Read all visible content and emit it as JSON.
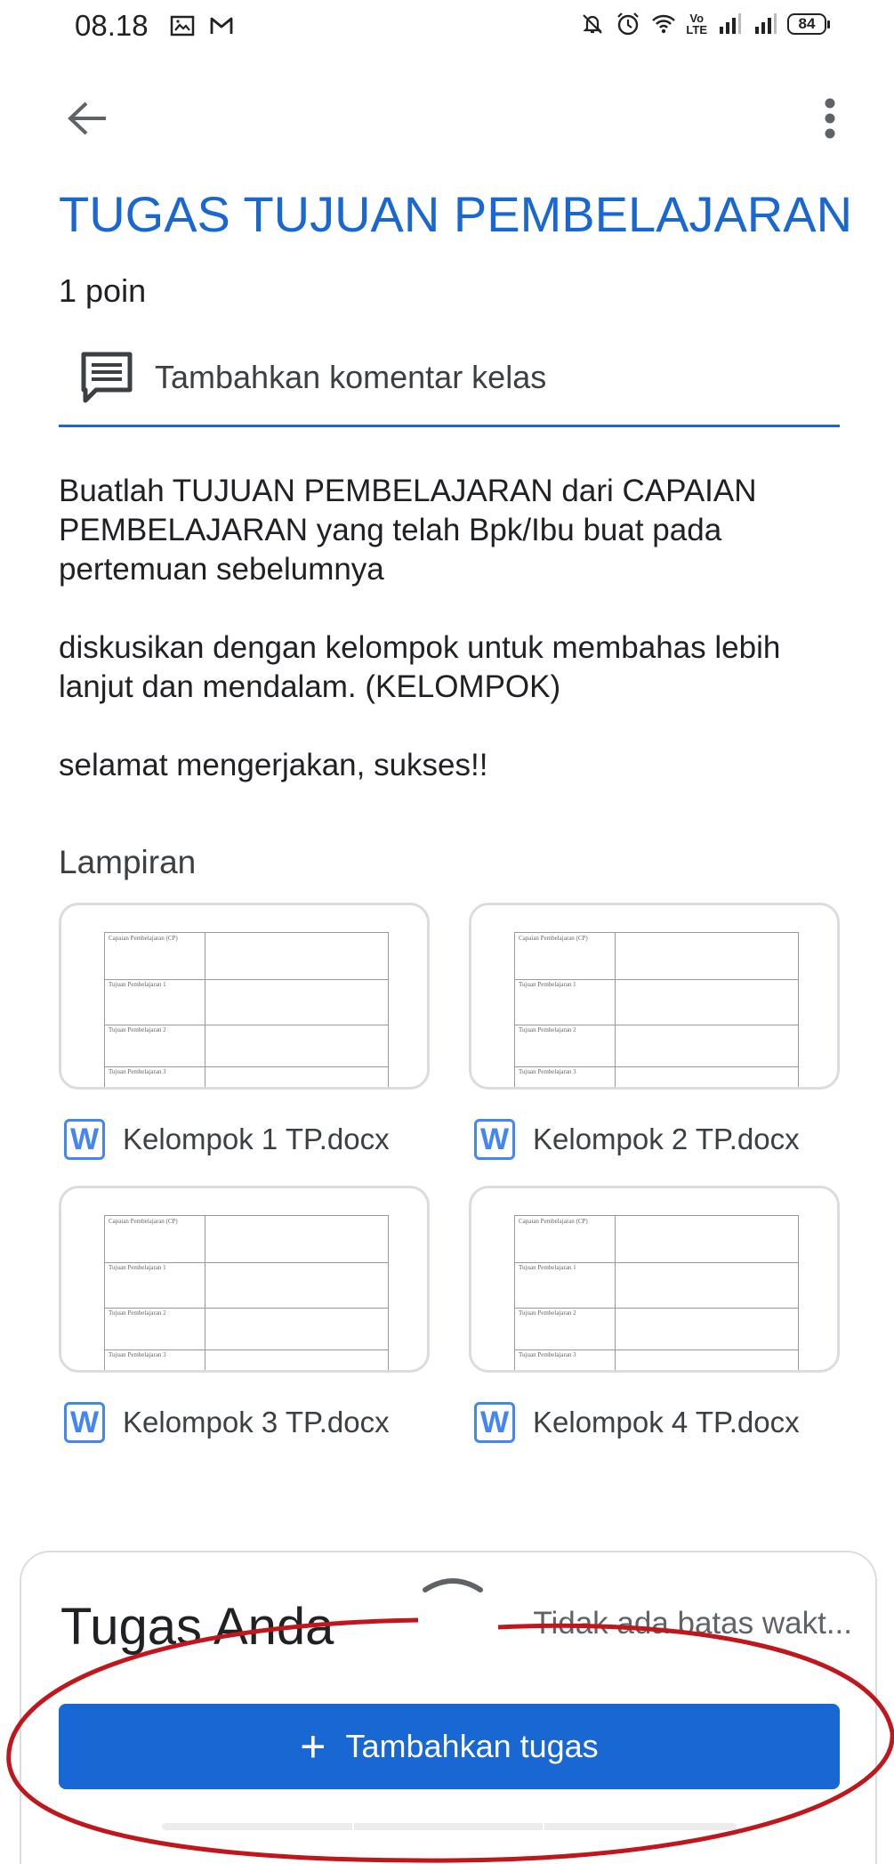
{
  "status_bar": {
    "time": "08.18",
    "volte": "Vo\nLTE",
    "battery": "84",
    "left_icons": [
      "gallery-icon",
      "gmail-icon"
    ],
    "right_icons": [
      "bell-off-icon",
      "alarm-icon",
      "wifi-icon",
      "volte-icon",
      "signal-icon",
      "signal-icon",
      "battery-icon"
    ]
  },
  "header": {
    "back_icon": "arrow-back-icon",
    "more_icon": "more-vert-icon"
  },
  "assignment": {
    "title": "TUGAS TUJUAN PEMBELAJARAN",
    "points": "1 poin",
    "comment_placeholder": "Tambahkan komentar kelas",
    "description": [
      "Buatlah TUJUAN PEMBELAJARAN  dari CAPAIAN PEMBELAJARAN yang telah Bpk/Ibu buat pada pertemuan sebelumnya",
      "diskusikan dengan kelompok untuk membahas lebih lanjut dan mendalam. (KELOMPOK)",
      "selamat mengerjakan, sukses!!"
    ]
  },
  "attachments": {
    "heading": "Lampiran",
    "thumbnail_rows": [
      "Capaian Pembelajaran (CP)",
      "Tujuan Pembelajaran 1",
      "Tujuan Pembelajaran 2",
      "Tujuan Pembelajaran 3"
    ],
    "file_icon_letter": "W",
    "items": [
      {
        "name": "Kelompok 1 TP.docx"
      },
      {
        "name": "Kelompok 2 TP.docx"
      },
      {
        "name": "Kelompok 3 TP.docx"
      },
      {
        "name": "Kelompok 4 TP.docx"
      }
    ]
  },
  "your_work": {
    "title": "Tugas Anda",
    "due": "Tidak ada batas wakt...",
    "add_button": "Tambahkan tugas",
    "add_icon": "+"
  },
  "colors": {
    "accent": "#1967d2",
    "annotation": "#c0161c",
    "word_icon": "#4285f4"
  }
}
